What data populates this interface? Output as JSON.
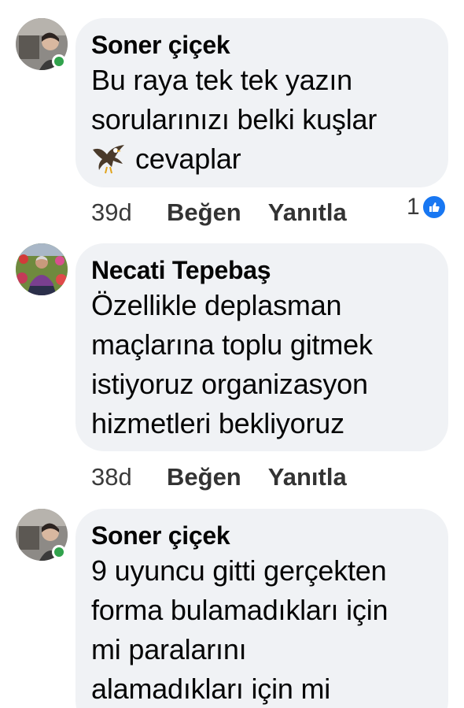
{
  "comments": [
    {
      "author": "Soner çiçek",
      "avatar_icon": "profile-photo",
      "online": true,
      "lines": [
        "Bu raya tek tek yazın",
        "sorularınızı belki kuşlar",
        "cevaplar"
      ],
      "emoji_icon": "eagle-icon",
      "time": "39d",
      "like_label": "Beğen",
      "reply_label": "Yanıtla",
      "reaction_count": "1",
      "reaction_icon": "like-icon"
    },
    {
      "author": "Necati Tepebaş",
      "avatar_icon": "profile-photo",
      "online": false,
      "lines": [
        "Özellikle deplasman",
        "maçlarına toplu gitmek",
        "istiyoruz organizasyon",
        "hizmetleri bekliyoruz"
      ],
      "time": "38d",
      "like_label": "Beğen",
      "reply_label": "Yanıtla"
    },
    {
      "author": "Soner çiçek",
      "avatar_icon": "profile-photo",
      "online": true,
      "lines": [
        "9 uyuncu gitti gerçekten",
        "forma bulamadıkları için",
        "mi paralarını",
        "alamadıkları için mi"
      ]
    }
  ],
  "colors": {
    "bubble": "#f0f2f5",
    "online": "#31a24c",
    "like_blue": "#1877f2"
  }
}
